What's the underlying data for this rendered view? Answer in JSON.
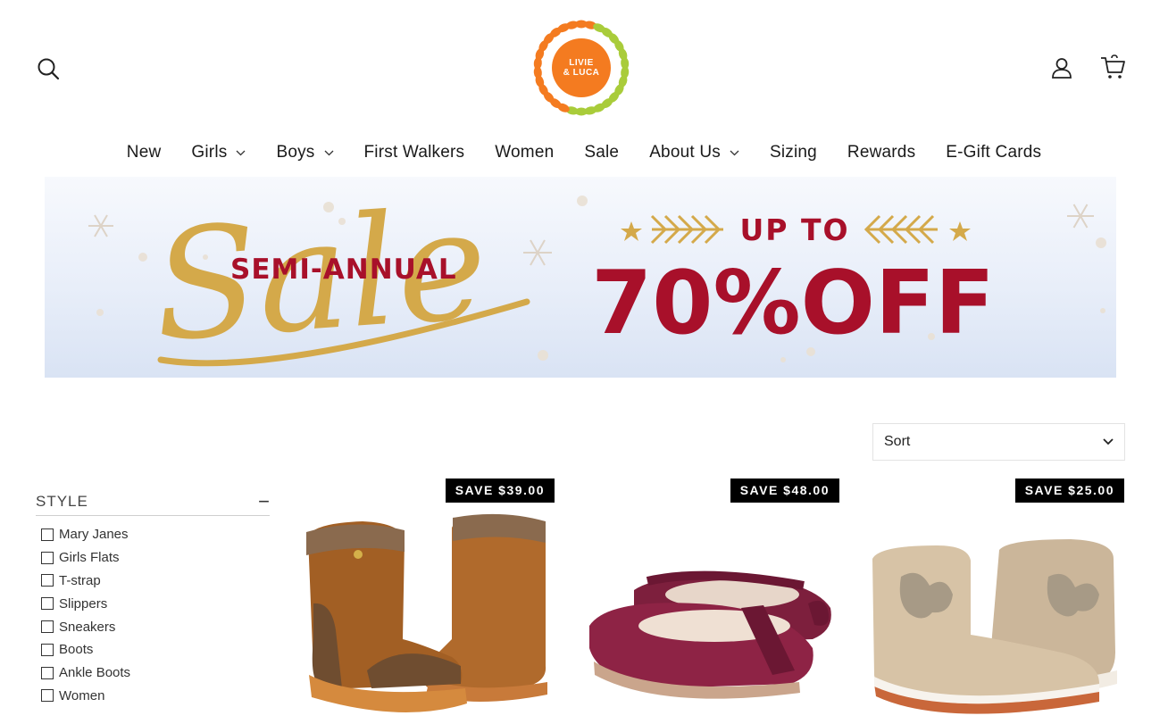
{
  "header": {
    "logo_line1": "LIVIE",
    "logo_line2": "& LUCA",
    "icons": [
      "search-icon",
      "user-icon",
      "cart-icon"
    ]
  },
  "nav": {
    "items": [
      {
        "label": "New",
        "dropdown": false
      },
      {
        "label": "Girls",
        "dropdown": true
      },
      {
        "label": "Boys",
        "dropdown": true
      },
      {
        "label": "First Walkers",
        "dropdown": false
      },
      {
        "label": "Women",
        "dropdown": false
      },
      {
        "label": "Sale",
        "dropdown": false
      },
      {
        "label": "About Us",
        "dropdown": true
      },
      {
        "label": "Sizing",
        "dropdown": false
      },
      {
        "label": "Rewards",
        "dropdown": false
      },
      {
        "label": "E-Gift Cards",
        "dropdown": false
      }
    ]
  },
  "banner": {
    "script_word": "Sale",
    "headline": "SEMI-ANNUAL",
    "up_to": "UP TO",
    "discount": "70%OFF",
    "colors": {
      "gold": "#d4a94a",
      "red": "#a8102a"
    }
  },
  "sort": {
    "label": "Sort"
  },
  "filters": {
    "title": "STYLE",
    "toggle": "−",
    "options": [
      "Mary Janes",
      "Girls Flats",
      "T-strap",
      "Slippers",
      "Sneakers",
      "Boots",
      "Ankle Boots",
      "Women"
    ]
  },
  "products": [
    {
      "badge": "SAVE $39.00",
      "image": "brown-suede-boots"
    },
    {
      "badge": "SAVE $48.00",
      "image": "burgundy-mary-janes"
    },
    {
      "badge": "SAVE $25.00",
      "image": "taupe-butterfly-ankle-boots"
    }
  ]
}
